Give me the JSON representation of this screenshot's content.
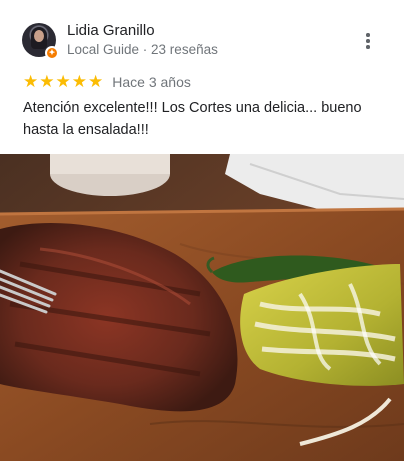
{
  "review": {
    "author": "Lidia Granillo",
    "author_meta": "Local Guide · 23 reseñas",
    "rating": 5,
    "rating_stars": [
      "★",
      "★",
      "★",
      "★",
      "★"
    ],
    "time": "Hace 3 años",
    "text": "Atención excelente!!! Los Cortes una delicia... bueno hasta la ensalada!!!",
    "more_icon": "more-vert-icon",
    "star_color": "#fbbc04",
    "badge_color": "#f57c00"
  }
}
